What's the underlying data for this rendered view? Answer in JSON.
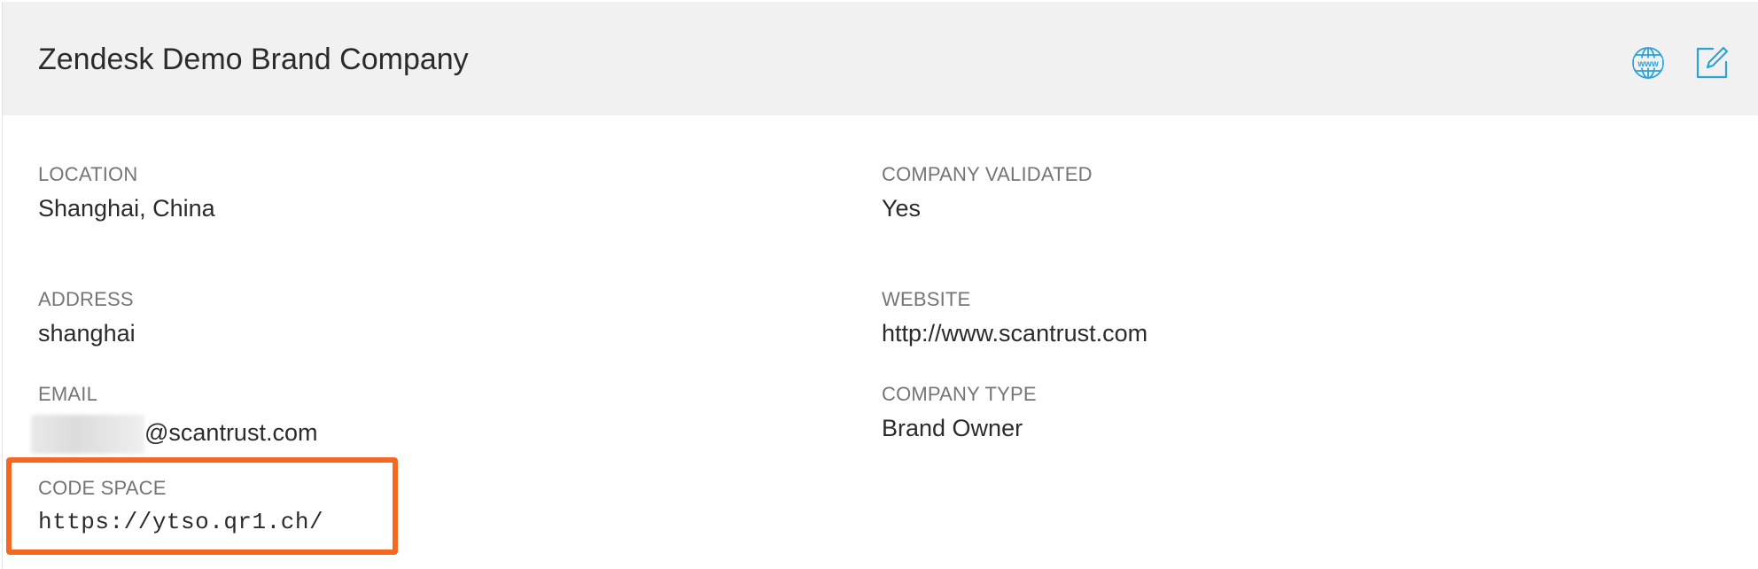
{
  "header": {
    "title": "Zendesk Demo Brand Company",
    "website_icon": "www-globe-icon",
    "edit_icon": "edit-icon"
  },
  "fields": {
    "location": {
      "label": "LOCATION",
      "value": "Shanghai, China"
    },
    "company_validated": {
      "label": "COMPANY VALIDATED",
      "value": "Yes"
    },
    "address": {
      "label": "ADDRESS",
      "value": "shanghai"
    },
    "website": {
      "label": "WEBSITE",
      "value": "http://www.scantrust.com"
    },
    "email": {
      "label": "EMAIL",
      "value": "@scantrust.com"
    },
    "company_type": {
      "label": "COMPANY TYPE",
      "value": "Brand Owner"
    },
    "code_space": {
      "label": "CODE SPACE",
      "value": "https://ytso.qr1.ch/"
    }
  },
  "colors": {
    "accent": "#2aa3d8",
    "highlight": "#f4681f",
    "header_bg": "#f1f1f1"
  }
}
